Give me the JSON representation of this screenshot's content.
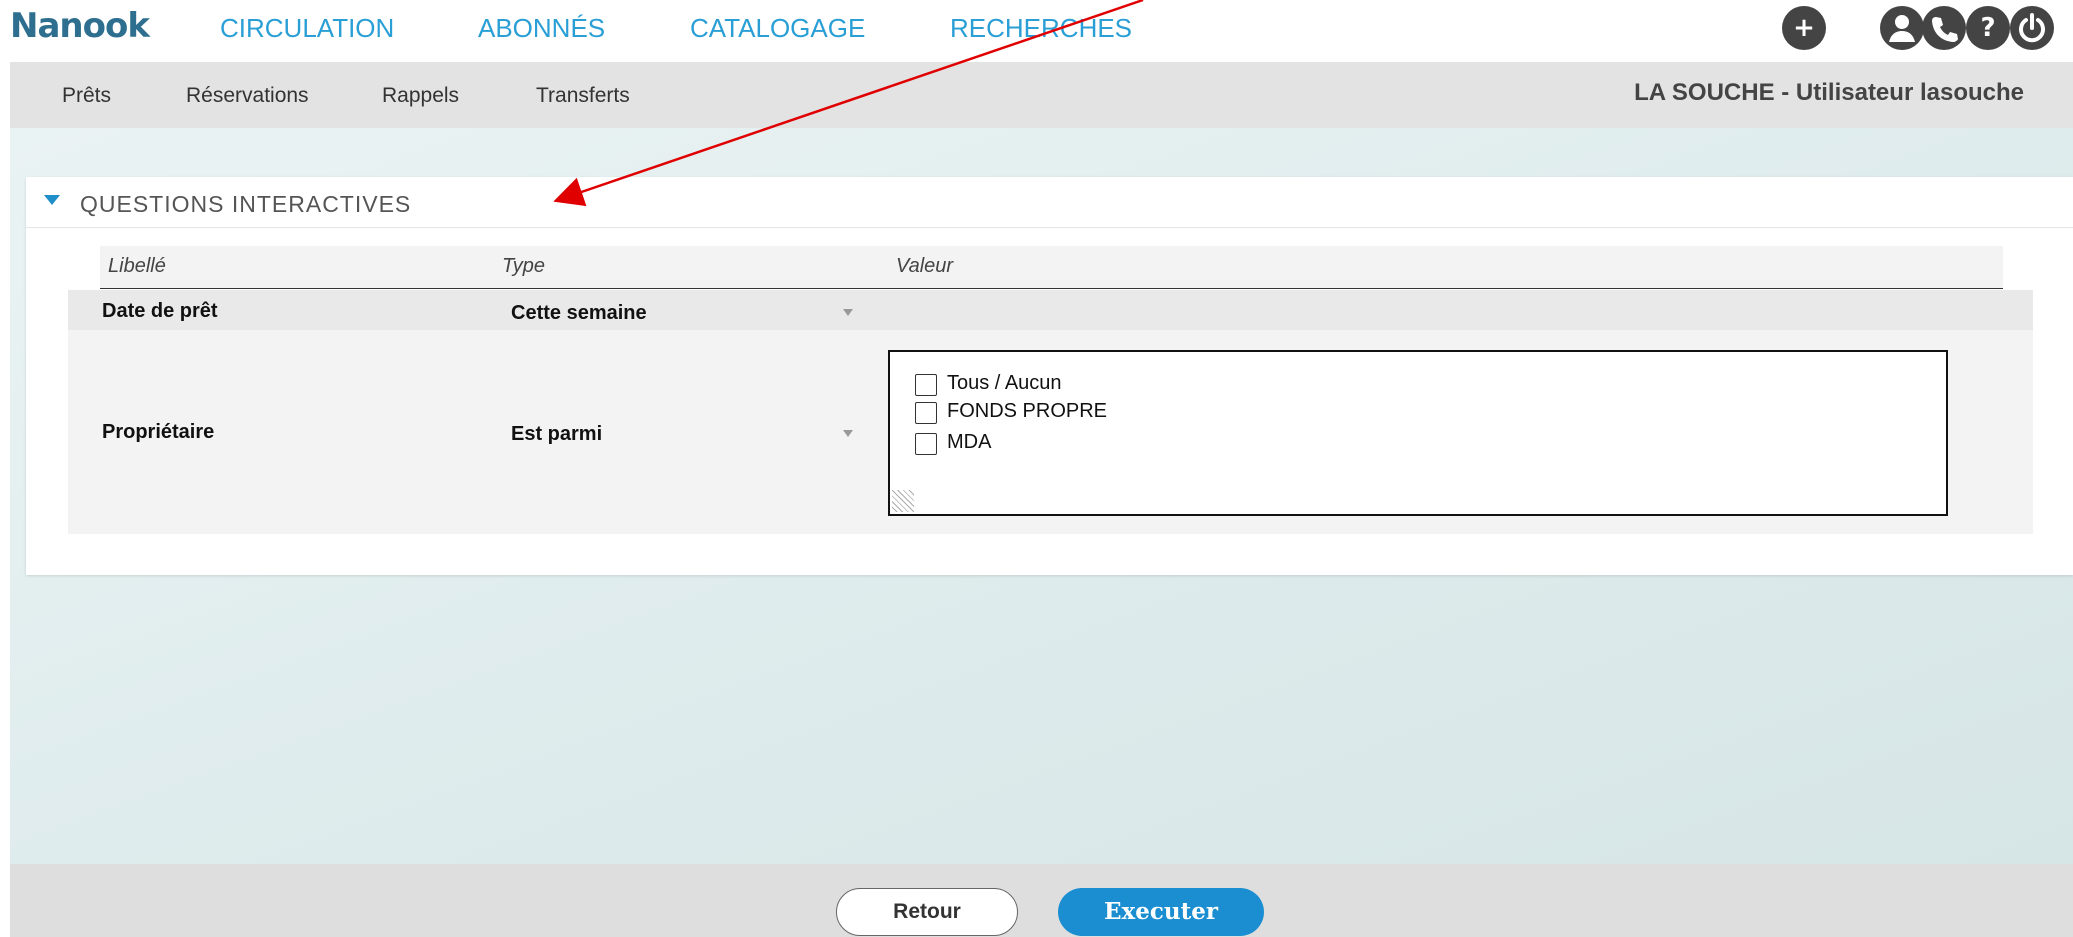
{
  "app": {
    "logo": "Nanook"
  },
  "header": {
    "nav": [
      "CIRCULATION",
      "ABONNÉS",
      "CATALOGAGE",
      "RECHERCHES"
    ]
  },
  "subnav": {
    "items": [
      "Prêts",
      "Réservations",
      "Rappels",
      "Transferts"
    ],
    "user_label": "LA SOUCHE - Utilisateur lasouche"
  },
  "panel": {
    "title": "QUESTIONS INTERACTIVES",
    "columns": {
      "label": "Libellé",
      "type": "Type",
      "value": "Valeur"
    },
    "rows": [
      {
        "label": "Date de prêt",
        "type": "Cette semaine"
      },
      {
        "label": "Propriétaire",
        "type": "Est parmi",
        "options": [
          "Tous / Aucun",
          "FONDS PROPRE",
          "MDA"
        ]
      }
    ]
  },
  "footer": {
    "back_label": "Retour",
    "execute_label": "Executer"
  },
  "colors": {
    "accent": "#1a8ed0",
    "nav_text": "#2a9fd6",
    "annotation_arrow": "#e00000"
  }
}
